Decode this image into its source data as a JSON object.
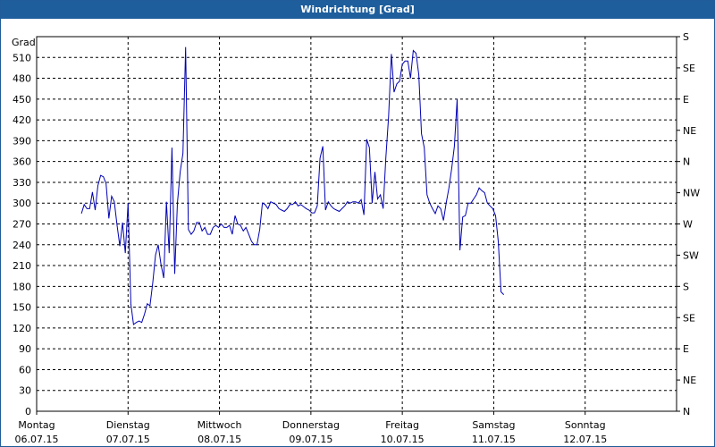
{
  "window": {
    "title": "Windrichtung [Grad]"
  },
  "chart_data": {
    "type": "line",
    "title": "Windrichtung [Grad]",
    "ylabel": "Grad",
    "ylim": [
      0,
      540
    ],
    "yticks": [
      0,
      30,
      60,
      90,
      120,
      150,
      180,
      210,
      240,
      270,
      300,
      330,
      360,
      390,
      420,
      450,
      480,
      510
    ],
    "right_axis_labels": [
      {
        "value": 540,
        "label": "S"
      },
      {
        "value": 495,
        "label": "SE"
      },
      {
        "value": 450,
        "label": "E"
      },
      {
        "value": 405,
        "label": "NE"
      },
      {
        "value": 360,
        "label": "N"
      },
      {
        "value": 315,
        "label": "NW"
      },
      {
        "value": 270,
        "label": "W"
      },
      {
        "value": 225,
        "label": "SW"
      },
      {
        "value": 180,
        "label": "S"
      },
      {
        "value": 135,
        "label": "SE"
      },
      {
        "value": 90,
        "label": "E"
      },
      {
        "value": 45,
        "label": "NE"
      },
      {
        "value": 0,
        "label": "N"
      }
    ],
    "xlim": [
      0,
      7
    ],
    "x_unit": "days since Montag 06.07.15 00:00",
    "xticks": [
      {
        "day": "Montag",
        "date": "06.07.15"
      },
      {
        "day": "Dienstag",
        "date": "07.07.15"
      },
      {
        "day": "Mittwoch",
        "date": "08.07.15"
      },
      {
        "day": "Donnerstag",
        "date": "09.07.15"
      },
      {
        "day": "Freitag",
        "date": "10.07.15"
      },
      {
        "day": "Samstag",
        "date": "11.07.15"
      },
      {
        "day": "Sonntag",
        "date": "12.07.15"
      }
    ],
    "grid": true,
    "series": [
      {
        "color": "#0000b4",
        "points": [
          [
            0.49,
            285
          ],
          [
            0.52,
            298
          ],
          [
            0.55,
            292
          ],
          [
            0.58,
            292
          ],
          [
            0.61,
            316
          ],
          [
            0.64,
            290
          ],
          [
            0.67,
            325
          ],
          [
            0.7,
            340
          ],
          [
            0.73,
            338
          ],
          [
            0.76,
            328
          ],
          [
            0.79,
            278
          ],
          [
            0.82,
            310
          ],
          [
            0.85,
            302
          ],
          [
            0.88,
            268
          ],
          [
            0.91,
            238
          ],
          [
            0.94,
            272
          ],
          [
            0.97,
            228
          ],
          [
            1.0,
            300
          ],
          [
            1.03,
            155
          ],
          [
            1.06,
            125
          ],
          [
            1.09,
            128
          ],
          [
            1.12,
            130
          ],
          [
            1.15,
            128
          ],
          [
            1.18,
            140
          ],
          [
            1.21,
            155
          ],
          [
            1.24,
            152
          ],
          [
            1.27,
            185
          ],
          [
            1.3,
            225
          ],
          [
            1.33,
            240
          ],
          [
            1.36,
            212
          ],
          [
            1.39,
            192
          ],
          [
            1.42,
            302
          ],
          [
            1.45,
            228
          ],
          [
            1.48,
            380
          ],
          [
            1.51,
            198
          ],
          [
            1.54,
            300
          ],
          [
            1.57,
            345
          ],
          [
            1.6,
            372
          ],
          [
            1.63,
            525
          ],
          [
            1.66,
            262
          ],
          [
            1.69,
            255
          ],
          [
            1.72,
            260
          ],
          [
            1.75,
            272
          ],
          [
            1.78,
            272
          ],
          [
            1.81,
            260
          ],
          [
            1.84,
            265
          ],
          [
            1.87,
            255
          ],
          [
            1.9,
            255
          ],
          [
            1.93,
            265
          ],
          [
            1.96,
            268
          ],
          [
            1.99,
            265
          ],
          [
            2.02,
            270
          ],
          [
            2.05,
            265
          ],
          [
            2.08,
            265
          ],
          [
            2.11,
            268
          ],
          [
            2.14,
            255
          ],
          [
            2.17,
            282
          ],
          [
            2.2,
            270
          ],
          [
            2.23,
            268
          ],
          [
            2.26,
            260
          ],
          [
            2.29,
            265
          ],
          [
            2.32,
            255
          ],
          [
            2.35,
            245
          ],
          [
            2.38,
            240
          ],
          [
            2.41,
            240
          ],
          [
            2.44,
            262
          ],
          [
            2.47,
            300
          ],
          [
            2.5,
            298
          ],
          [
            2.53,
            292
          ],
          [
            2.56,
            302
          ],
          [
            2.59,
            300
          ],
          [
            2.62,
            298
          ],
          [
            2.65,
            292
          ],
          [
            2.68,
            290
          ],
          [
            2.71,
            288
          ],
          [
            2.74,
            292
          ],
          [
            2.77,
            298
          ],
          [
            2.8,
            298
          ],
          [
            2.83,
            302
          ],
          [
            2.86,
            296
          ],
          [
            2.89,
            298
          ],
          [
            2.92,
            295
          ],
          [
            2.95,
            292
          ],
          [
            2.98,
            290
          ],
          [
            3.01,
            286
          ],
          [
            3.04,
            286
          ],
          [
            3.07,
            296
          ],
          [
            3.1,
            365
          ],
          [
            3.13,
            382
          ],
          [
            3.16,
            290
          ],
          [
            3.19,
            302
          ],
          [
            3.22,
            296
          ],
          [
            3.25,
            292
          ],
          [
            3.28,
            290
          ],
          [
            3.31,
            288
          ],
          [
            3.34,
            292
          ],
          [
            3.37,
            296
          ],
          [
            3.4,
            302
          ],
          [
            3.43,
            300
          ],
          [
            3.46,
            302
          ],
          [
            3.49,
            302
          ],
          [
            3.52,
            300
          ],
          [
            3.55,
            305
          ],
          [
            3.58,
            283
          ],
          [
            3.61,
            392
          ],
          [
            3.64,
            380
          ],
          [
            3.67,
            300
          ],
          [
            3.7,
            345
          ],
          [
            3.73,
            306
          ],
          [
            3.76,
            312
          ],
          [
            3.79,
            292
          ],
          [
            3.82,
            365
          ],
          [
            3.85,
            425
          ],
          [
            3.88,
            515
          ],
          [
            3.91,
            460
          ],
          [
            3.94,
            472
          ],
          [
            3.97,
            476
          ],
          [
            4.0,
            500
          ],
          [
            4.03,
            505
          ],
          [
            4.06,
            505
          ],
          [
            4.09,
            480
          ],
          [
            4.12,
            520
          ],
          [
            4.15,
            516
          ],
          [
            4.18,
            485
          ],
          [
            4.21,
            400
          ],
          [
            4.24,
            380
          ],
          [
            4.27,
            312
          ],
          [
            4.3,
            300
          ],
          [
            4.33,
            292
          ],
          [
            4.36,
            285
          ],
          [
            4.39,
            296
          ],
          [
            4.42,
            292
          ],
          [
            4.45,
            275
          ],
          [
            4.48,
            300
          ],
          [
            4.51,
            322
          ],
          [
            4.54,
            350
          ],
          [
            4.57,
            382
          ],
          [
            4.6,
            450
          ],
          [
            4.63,
            232
          ],
          [
            4.66,
            280
          ],
          [
            4.69,
            282
          ],
          [
            4.72,
            300
          ],
          [
            4.75,
            300
          ],
          [
            4.78,
            306
          ],
          [
            4.81,
            312
          ],
          [
            4.84,
            322
          ],
          [
            4.87,
            318
          ],
          [
            4.9,
            315
          ],
          [
            4.93,
            300
          ],
          [
            4.96,
            296
          ],
          [
            4.99,
            292
          ],
          [
            5.02,
            282
          ],
          [
            5.05,
            245
          ],
          [
            5.08,
            172
          ],
          [
            5.11,
            168
          ]
        ]
      }
    ]
  }
}
